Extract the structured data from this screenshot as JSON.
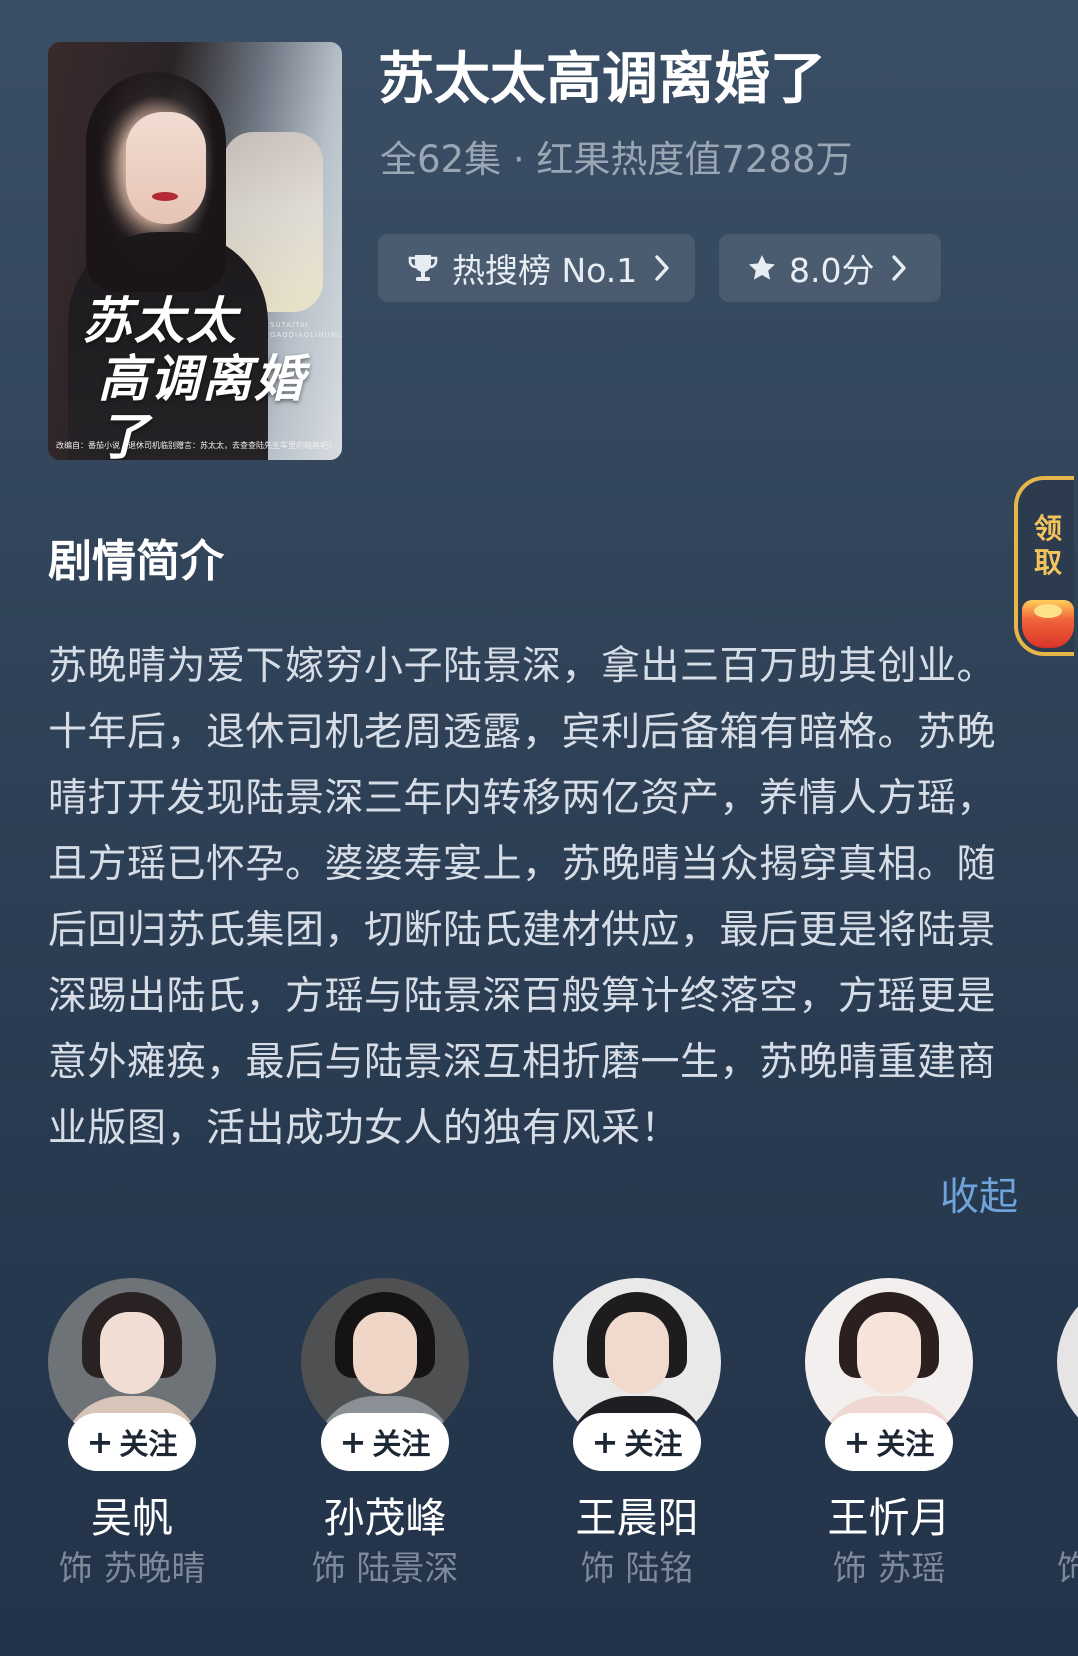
{
  "drama": {
    "title": "苏太太高调离婚了",
    "meta": "全62集 · 红果热度值7288万",
    "poster": {
      "logo_line1": "苏太太",
      "logo_line2": "高调离婚了",
      "logo_sub": "SUTAITAI GAODIAOLIHUNLE",
      "credit": "改编自：番茄小说《退休司机临别赠言：苏太太，去查查陆先生车里的暗格吧》"
    }
  },
  "badges": {
    "rank": {
      "icon": "trophy-icon",
      "label": "热搜榜 No.1"
    },
    "score": {
      "icon": "star-icon",
      "label": "8.0分"
    }
  },
  "side_tab": {
    "label_1": "领",
    "label_2": "取",
    "icon": "red-envelope-icon"
  },
  "synopsis": {
    "heading": "剧情简介",
    "text": "苏晚晴为爱下嫁穷小子陆景深，拿出三百万助其创业。十年后，退休司机老周透露，宾利后备箱有暗格。苏晚晴打开发现陆景深三年内转移两亿资产，养情人方瑶，且方瑶已怀孕。婆婆寿宴上，苏晚晴当众揭穿真相。随后回归苏氏集团，切断陆氏建材供应，最后更是将陆景深踢出陆氏，方瑶与陆景深百般算计终落空，方瑶更是意外瘫痪，最后与陆景深互相折磨一生，苏晚晴重建商业版图，活出成功女人的独有风采！",
    "collapse_label": "收起"
  },
  "cast": [
    {
      "name": "吴帆",
      "role": "饰 苏晚晴",
      "follow_label": "关注"
    },
    {
      "name": "孙茂峰",
      "role": "饰 陆景深",
      "follow_label": "关注"
    },
    {
      "name": "王晨阳",
      "role": "饰 陆铭",
      "follow_label": "关注"
    },
    {
      "name": "王忻月",
      "role": "饰 苏瑶",
      "follow_label": "关注"
    },
    {
      "name": "",
      "role": "饰",
      "follow_label": ""
    }
  ],
  "colors": {
    "background_top": "#3a4e65",
    "background_bottom": "#22334a",
    "accent_link": "#6fa3d9",
    "side_tab_gold": "#e7b64b"
  }
}
